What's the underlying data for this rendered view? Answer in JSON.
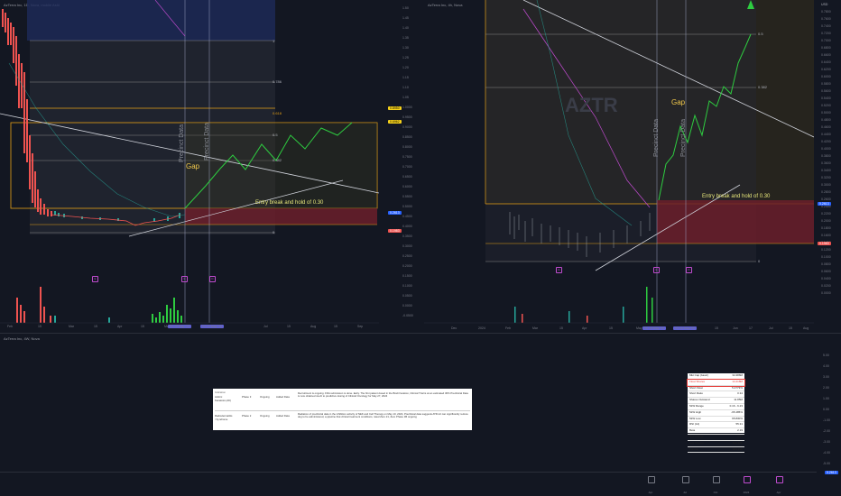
{
  "left_chart": {
    "symbol": "AzTerra Inc, 1D, Nova, mobile Ashl",
    "gap_label": "Gap",
    "entry_label": "Entry break and hold of 0.30",
    "precinct_a": "Precinct Data",
    "precinct_b": "Precinct Data",
    "fib_levels": [
      "1",
      "0.786",
      "0.618",
      "0.5",
      "0.382",
      "0"
    ],
    "price_ticks": [
      "1.50",
      "1.45",
      "1.40",
      "1.35",
      "1.30",
      "1.25",
      "1.20",
      "1.15",
      "1.10",
      "1.05",
      "1.0000",
      "0.9500",
      "0.9000",
      "0.8500",
      "0.8000",
      "0.7500",
      "0.7000",
      "0.6500",
      "0.6000",
      "0.5500",
      "0.5000",
      "0.4500",
      "0.4000",
      "0.3500",
      "0.3000",
      "0.2500",
      "0.2000",
      "0.1500",
      "0.1000",
      "0.0500",
      "0.0000",
      "-0.0500"
    ],
    "x_ticks": [
      "Feb",
      "15",
      "Mar",
      "15",
      "Apr",
      "15",
      "May",
      "Jul",
      "15",
      "Aug",
      "15",
      "Sep",
      "17"
    ],
    "date_tag_a": "Fri 10 May '24",
    "date_tag_b": "Fri 24 May '24",
    "price_tag_top": "0.8950",
    "price_tag_mid": "0.6962",
    "price_tag_blue": "0.2613",
    "price_tag_red": "0.1983"
  },
  "right_chart": {
    "symbol": "AzTerra Inc, 4h, Nova",
    "gap_label": "Gap",
    "entry_label": "Entry break and hold of 0.30",
    "precinct_a": "Precinct Data",
    "precinct_b": "Precinct Data",
    "watermark": "AZTR",
    "fib_levels": [
      "0.5",
      "0.382",
      "0"
    ],
    "price_ticks": [
      "0.7800",
      "0.7600",
      "0.7400",
      "0.7200",
      "0.7000",
      "0.6800",
      "0.6600",
      "0.6400",
      "0.6200",
      "0.6000",
      "0.5800",
      "0.5600",
      "0.5400",
      "0.5200",
      "0.5000",
      "0.4800",
      "0.4600",
      "0.4400",
      "0.4200",
      "0.4000",
      "0.3800",
      "0.3600",
      "0.3400",
      "0.3200",
      "0.3000",
      "0.2800",
      "0.2600",
      "0.2400",
      "0.2200",
      "0.2000",
      "0.1800",
      "0.1600",
      "0.1400",
      "0.1200",
      "0.1000",
      "0.0800",
      "0.0600",
      "0.0400",
      "0.0200",
      "0.0000"
    ],
    "x_ticks": [
      "Dec",
      "2024",
      "Feb",
      "Mar",
      "15",
      "Apr",
      "15",
      "May",
      "15",
      "Jun",
      "17",
      "Jul",
      "15",
      "Aug"
    ],
    "date_tag_a": "Fri 10 May '24",
    "date_tag_b": "Fri 24 May '24",
    "currency": "USD",
    "price_tag_blue": "0.2613",
    "price_tag_red": "0.1983"
  },
  "bottom_pane": {
    "symbol": "AzTerra Inc, 4W, Nova",
    "price_ticks": [
      "5.00",
      "4.00",
      "3.00",
      "2.00",
      "1.00",
      "0.00",
      "-1.00",
      "-2.00",
      "-3.00",
      "-4.00",
      "-5.00"
    ],
    "price_tag": "0.2613",
    "dates": [
      "Apr",
      "Jul",
      "Oct",
      "2024",
      "Apr"
    ],
    "table": {
      "headers": [
        "Indication",
        "Phase",
        "Status",
        "Details"
      ],
      "rows": [
        {
          "name": "Actinic Keratosis (AK)",
          "phase": "Phase 3",
          "status": "Ongoing",
          "note": "Added Data",
          "text": "Recruitment is ongoing. FDA submission is done. Early. The first patient dosed in the Brazil location, Clinical Trial is at an estimated 30% Preclinical Data is now obtained via AI to predictive dosing of Clinical Oncology for May 27, 2024"
        },
        {
          "name": "Radiodermatitis / Syndrome",
          "phase": "Phase 2",
          "status": "Ongoing",
          "note": "Added Data",
          "text": "Radiation of preclinical data in the inhibition activity of NEK and Cell Therapy on May 10, 2024, Preclinical data suggests ATR-12 can significantly reduce dog to be administered, a pipeline that clinical treatment conditions, rated Zero 21, Zero Phase 1B ongoing"
        }
      ]
    },
    "stats": [
      {
        "label": "Mkt Cap (basic)",
        "value": "34.386M"
      },
      {
        "label": "Float Shares",
        "value": "14.418M"
      },
      {
        "label": "Short Float",
        "value": "5.4773%"
      },
      {
        "label": "Short Ratio",
        "value": "0.34"
      },
      {
        "label": "Shares Outstand",
        "value": "11.85M"
      },
      {
        "label": "52W Range",
        "value": "0.16 - 6.23"
      },
      {
        "label": "52W High",
        "value": "-95.485%"
      },
      {
        "label": "52W Low",
        "value": "65.830%"
      },
      {
        "label": "RSI (14)",
        "value": "55.31"
      },
      {
        "label": "Beta",
        "value": "2.19"
      },
      {
        "label": "Rel Volume",
        "value": "0.53"
      },
      {
        "label": "Avg Volume",
        "value": "819.48K"
      },
      {
        "label": "Volume",
        "value": "409.19K"
      }
    ]
  },
  "colors": {
    "background": "#131722",
    "up": "#26a69a",
    "down": "#ef5350",
    "green_line": "#2ecc40",
    "gap_text": "#f2c94c",
    "entry_text": "#e6e67a",
    "orange_box": "#e6a117"
  }
}
